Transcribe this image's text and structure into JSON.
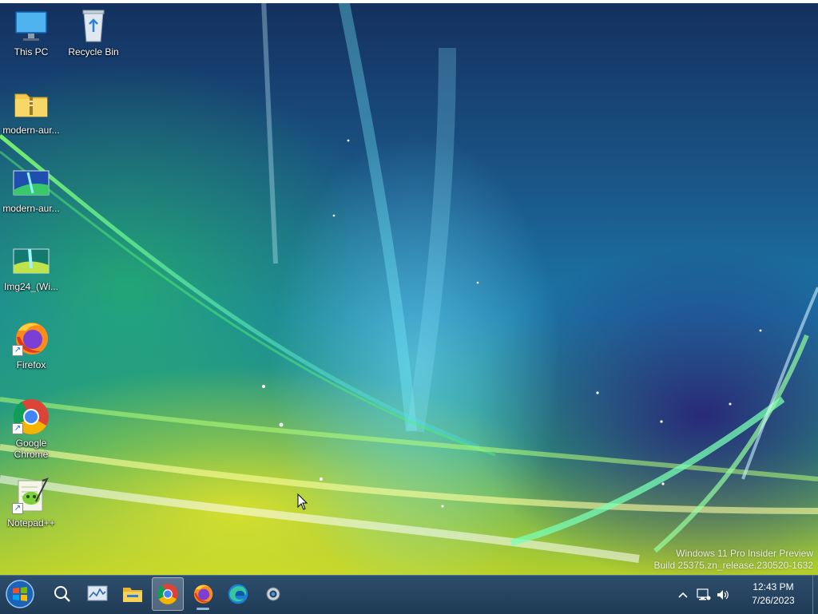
{
  "desktop": {
    "icons": [
      {
        "label": "This PC",
        "icon": "monitor-icon"
      },
      {
        "label": "Recycle Bin",
        "icon": "recycle-bin-icon"
      },
      {
        "label": "modern-aur...",
        "icon": "zip-folder-icon"
      },
      {
        "label": "modern-aur...",
        "icon": "image-file-icon"
      },
      {
        "label": "Img24_(Wi...",
        "icon": "image-file-icon"
      },
      {
        "label": "Firefox",
        "icon": "firefox-icon"
      },
      {
        "label": "Google Chrome",
        "icon": "chrome-icon"
      },
      {
        "label": "Notepad++",
        "icon": "notepad-plus-plus-icon"
      }
    ],
    "watermark": {
      "line1": "Windows 11 Pro Insider Preview",
      "line2": "Build 25375.zn_release.230520-1632"
    }
  },
  "taskbar": {
    "start": "start-orb-icon",
    "items": [
      {
        "name": "search",
        "icon": "search-icon",
        "active": false
      },
      {
        "name": "task-manager",
        "icon": "task-manager-icon",
        "active": false
      },
      {
        "name": "file-explorer",
        "icon": "folder-icon",
        "active": false
      },
      {
        "name": "chrome",
        "icon": "chrome-icon",
        "active": true
      },
      {
        "name": "firefox",
        "icon": "firefox-icon",
        "active": false,
        "running": true
      },
      {
        "name": "edge",
        "icon": "edge-icon",
        "active": false
      },
      {
        "name": "settings",
        "icon": "gear-icon",
        "active": false
      }
    ],
    "tray": {
      "time": "12:43 PM",
      "date": "7/26/2023"
    }
  },
  "colors": {
    "taskbar": "#1f3a55",
    "accent": "#8fb6d6"
  }
}
